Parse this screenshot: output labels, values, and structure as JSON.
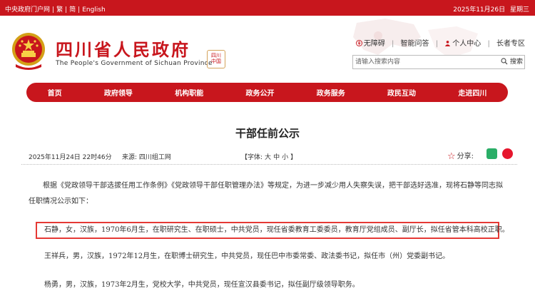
{
  "topbar": {
    "portal_link": "中央政府门户网",
    "traditional": "繁",
    "simplified": "简",
    "english": "English",
    "separator": "|",
    "date": "2025年11月26日",
    "weekday": "星期三"
  },
  "header": {
    "title": "四川省人民政府",
    "subtitle": "The People's Government of Sichuan Province",
    "seal_text": "四川中国"
  },
  "quicklinks": {
    "accessibility": "无障碍",
    "smart_qa": "智能问答",
    "personal_center": "个人中心",
    "elderly": "长者专区",
    "divider": "|"
  },
  "search": {
    "placeholder": "请输入搜索内容",
    "button_label": "搜索"
  },
  "nav": {
    "items": [
      "首页",
      "政府领导",
      "机构职能",
      "政务公开",
      "政务服务",
      "政民互动",
      "走进四川"
    ]
  },
  "article": {
    "title": "干部任前公示",
    "date": "2025年11月24日 22时46分",
    "source": "来源: 四川组工网",
    "font_label": "【字体:",
    "font_large": "大",
    "font_medium": "中",
    "font_small": "小",
    "font_close": "】",
    "share_label": "分享:",
    "intro": "根据《党政领导干部选拔任用工作条例》《党政领导干部任职管理办法》等规定，为进一步减少用人失察失误，把干部选好选准，现将石静等同志拟任职情况公示如下：",
    "p_shi": "石静，女，汉族，1970年6月生，在职研究生、在职硕士，中共党员，现任省委教育工委委员，教育厅党组成员、副厅长，拟任省管本科高校正职。",
    "p_wang": "王祥兵，男，汉族，1972年12月生，在职博士研究生，中共党员，现任巴中市委常委、政法委书记，拟任市（州）党委副书记。",
    "p_yang": "杨勇，男，汉族，1973年2月生，党校大学，中共党员，现任宣汉县委书记，拟任副厅级领导职务。"
  },
  "colors": {
    "brand_red": "#c8161d",
    "highlight": "#e53935"
  }
}
